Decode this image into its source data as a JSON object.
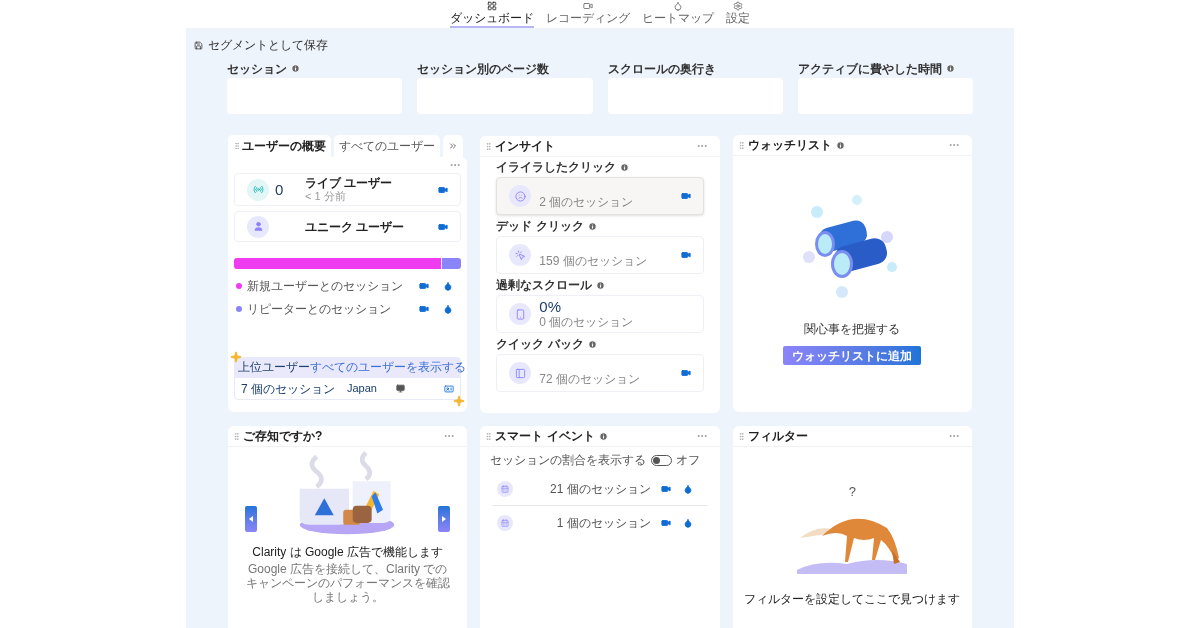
{
  "nav": [
    {
      "label": "ダッシュボード",
      "selected": true
    },
    {
      "label": "レコーディング",
      "selected": false
    },
    {
      "label": "ヒートマップ",
      "selected": false
    },
    {
      "label": "設定",
      "selected": false
    }
  ],
  "save_segment": {
    "label": "セグメントとして保存"
  },
  "metrics": [
    {
      "label": "セッション",
      "info": true
    },
    {
      "label": "セッション別のページ数",
      "info": false
    },
    {
      "label": "スクロールの奥行き",
      "info": false
    },
    {
      "label": "アクティブに費やした時間",
      "info": true
    }
  ],
  "users_widget": {
    "tabs": [
      {
        "label": "ユーザーの概要",
        "selected": true
      },
      {
        "label": "すべてのユーザー",
        "selected": false
      }
    ],
    "live": {
      "count": "0",
      "label": "ライブ ユーザー",
      "sublabel": "< 1 分前"
    },
    "unique": {
      "label": "ユニーク ユーザー"
    },
    "bar": [
      {
        "level": 0.91,
        "color": "#f03cf0"
      },
      {
        "level": 0.09,
        "color": "#8b84f8"
      }
    ],
    "legend": [
      {
        "label": "新規ユーザーとのセッション",
        "color": "#f03cf0"
      },
      {
        "label": "リピーターとのセッション",
        "color": "#8b84f8"
      }
    ],
    "top_users": {
      "title": "上位ユーザー",
      "link": "すべてのユーザーを表示する",
      "sessions": "7 個のセッション",
      "country": "Japan"
    }
  },
  "insights": {
    "title": "インサイト",
    "items": [
      {
        "label": "イライラしたクリック",
        "info": true,
        "highlighted": true,
        "sessions": "2 個のセッション"
      },
      {
        "label": "デッド クリック",
        "info": true,
        "highlighted": false,
        "sessions": "159 個のセッション"
      },
      {
        "label": "過剰なスクロール",
        "info": true,
        "highlighted": false,
        "value": "0%",
        "sessions": "0 個のセッション"
      },
      {
        "label": "クイック バック",
        "info": true,
        "highlighted": false,
        "sessions": "72 個のセッション"
      }
    ]
  },
  "watchlist": {
    "title": "ウォッチリスト",
    "info": true,
    "caption": "関心事を把握する",
    "button": "ウォッチリストに追加"
  },
  "tips": {
    "title": "ご存知ですか?",
    "headline": "Clarity は Google 広告で機能します",
    "body": "Google 広告を接続して、Clarity でのキャンペーンのパフォーマンスを確認しましょう。"
  },
  "smart_events": {
    "title": "スマート イベント",
    "info": true,
    "toggle": {
      "label": "セッションの割合を表示する",
      "on": false,
      "state_label": "オフ"
    },
    "rows": [
      {
        "sessions": "21 個のセッション"
      },
      {
        "sessions": "1 個のセッション"
      }
    ]
  },
  "filters": {
    "title": "フィルター",
    "mark": "?",
    "caption": "フィルターを設定してここで見つけます"
  }
}
